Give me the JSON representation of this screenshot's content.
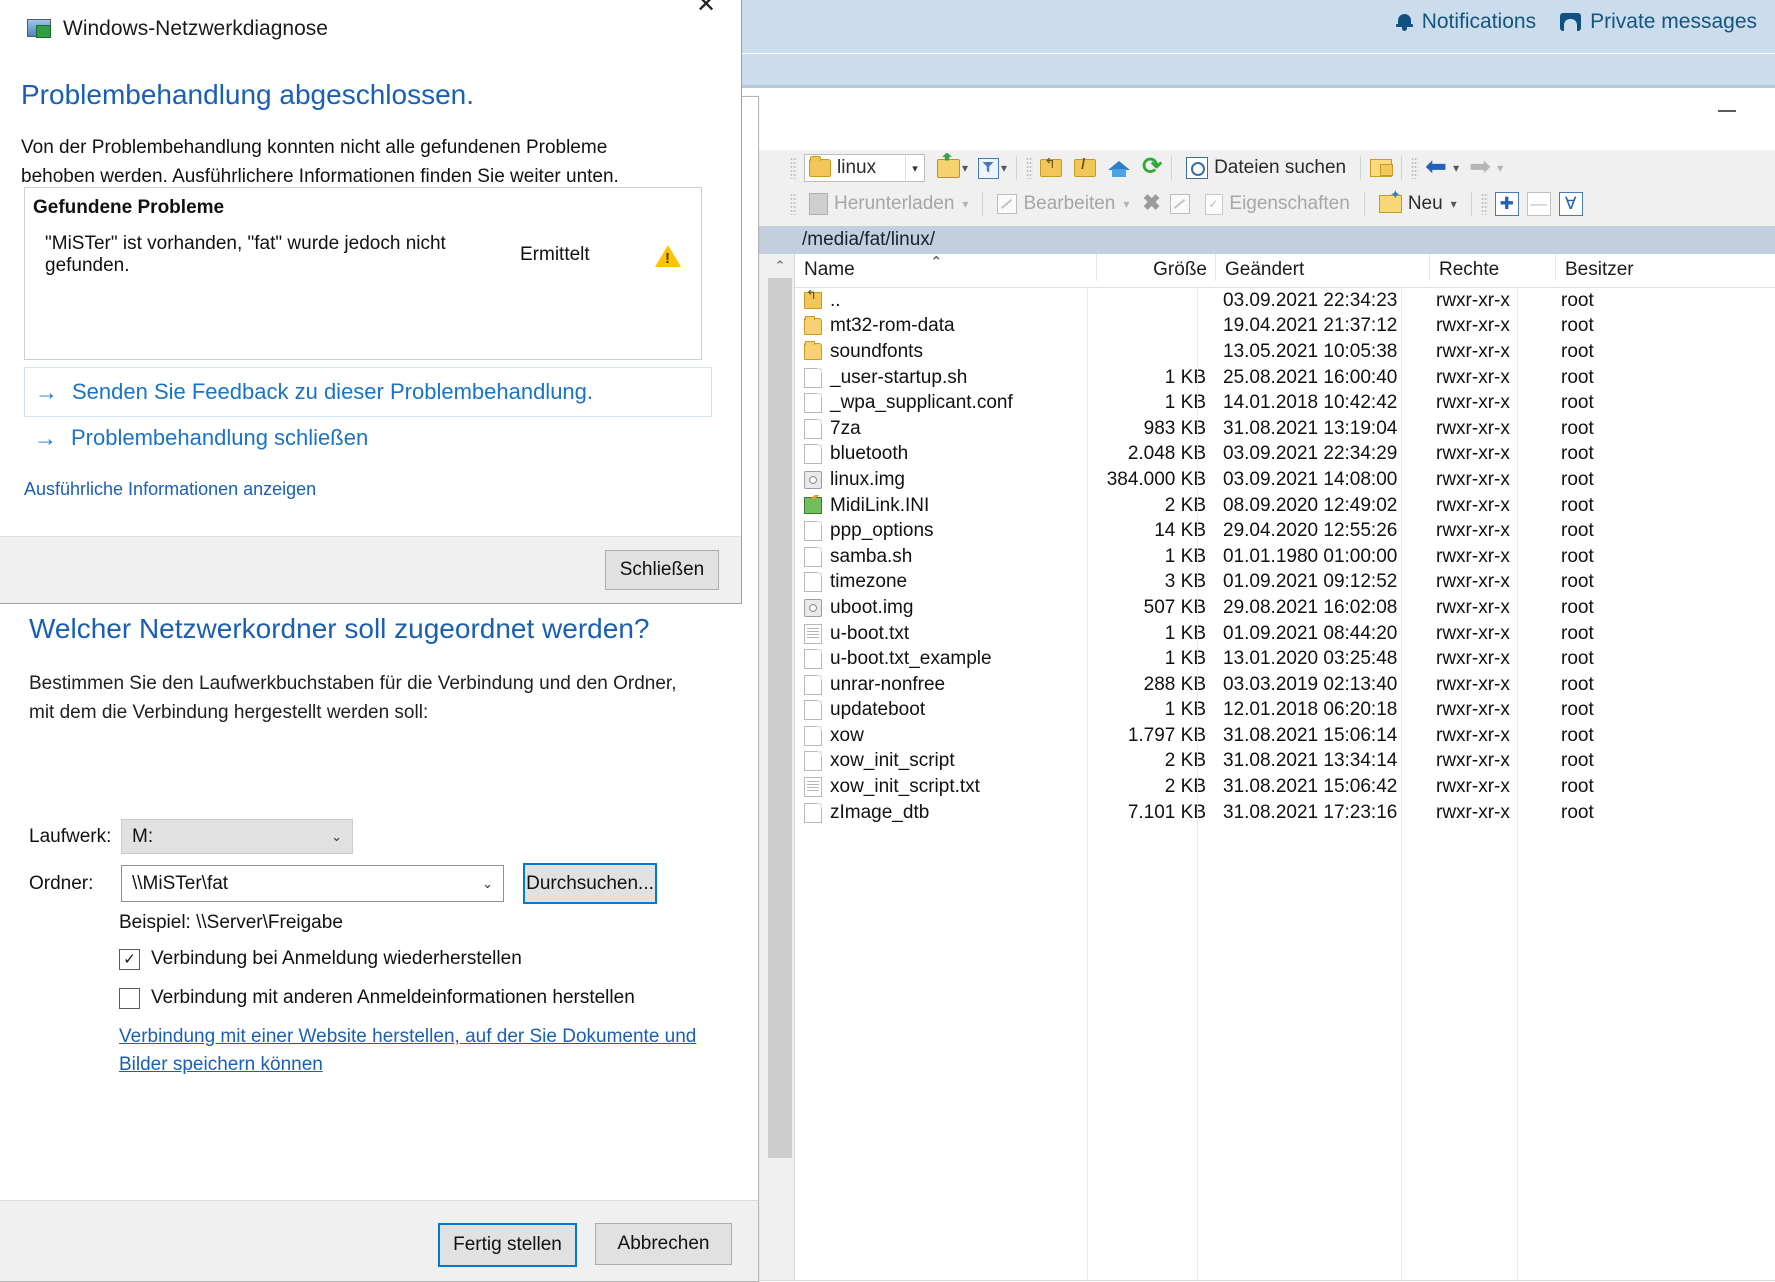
{
  "forum": {
    "notifications_label": "Notifications",
    "private_messages_label": "Private messages"
  },
  "file_manager": {
    "path_combo_value": "linux",
    "toolbar_top": [
      {
        "label": "Dateien suchen",
        "icon": "magnifier-icon"
      }
    ],
    "search_label": "Dateien suchen",
    "toolbar_second": {
      "download_label": "Herunterladen",
      "edit_label": "Bearbeiten",
      "properties_label": "Eigenschaften",
      "new_label": "Neu"
    },
    "path_bar": "/media/fat/linux/",
    "columns": [
      "Name",
      "Größe",
      "Geändert",
      "Rechte",
      "Besitzer"
    ],
    "rows": [
      {
        "icon": "folder-up-icon",
        "name": "..",
        "size": "",
        "modified": "03.09.2021 22:34:23",
        "perm": "rwxr-xr-x",
        "owner": "root"
      },
      {
        "icon": "folder-icon",
        "name": "mt32-rom-data",
        "size": "",
        "modified": "19.04.2021 21:37:12",
        "perm": "rwxr-xr-x",
        "owner": "root"
      },
      {
        "icon": "folder-icon",
        "name": "soundfonts",
        "size": "",
        "modified": "13.05.2021 10:05:38",
        "perm": "rwxr-xr-x",
        "owner": "root"
      },
      {
        "icon": "file-icon",
        "name": "_user-startup.sh",
        "size": "1 KB",
        "modified": "25.08.2021 16:00:40",
        "perm": "rwxr-xr-x",
        "owner": "root"
      },
      {
        "icon": "file-icon",
        "name": "_wpa_supplicant.conf",
        "size": "1 KB",
        "modified": "14.01.2018 10:42:42",
        "perm": "rwxr-xr-x",
        "owner": "root"
      },
      {
        "icon": "file-icon",
        "name": "7za",
        "size": "983 KB",
        "modified": "31.08.2021 13:19:04",
        "perm": "rwxr-xr-x",
        "owner": "root"
      },
      {
        "icon": "file-icon",
        "name": "bluetooth",
        "size": "2.048 KB",
        "modified": "03.09.2021 22:34:29",
        "perm": "rwxr-xr-x",
        "owner": "root"
      },
      {
        "icon": "disc-image-icon",
        "name": "linux.img",
        "size": "384.000 KB",
        "modified": "03.09.2021 14:08:00",
        "perm": "rwxr-xr-x",
        "owner": "root"
      },
      {
        "icon": "ini-file-icon",
        "name": "MidiLink.INI",
        "size": "2 KB",
        "modified": "08.09.2020 12:49:02",
        "perm": "rwxr-xr-x",
        "owner": "root"
      },
      {
        "icon": "file-icon",
        "name": "ppp_options",
        "size": "14 KB",
        "modified": "29.04.2020 12:55:26",
        "perm": "rwxr-xr-x",
        "owner": "root"
      },
      {
        "icon": "file-icon",
        "name": "samba.sh",
        "size": "1 KB",
        "modified": "01.01.1980 01:00:00",
        "perm": "rwxr-xr-x",
        "owner": "root"
      },
      {
        "icon": "file-icon",
        "name": "timezone",
        "size": "3 KB",
        "modified": "01.09.2021 09:12:52",
        "perm": "rwxr-xr-x",
        "owner": "root"
      },
      {
        "icon": "disc-image-icon",
        "name": "uboot.img",
        "size": "507 KB",
        "modified": "29.08.2021 16:02:08",
        "perm": "rwxr-xr-x",
        "owner": "root"
      },
      {
        "icon": "text-file-icon",
        "name": "u-boot.txt",
        "size": "1 KB",
        "modified": "01.09.2021 08:44:20",
        "perm": "rwxr-xr-x",
        "owner": "root"
      },
      {
        "icon": "file-icon",
        "name": "u-boot.txt_example",
        "size": "1 KB",
        "modified": "13.01.2020 03:25:48",
        "perm": "rwxr-xr-x",
        "owner": "root"
      },
      {
        "icon": "file-icon",
        "name": "unrar-nonfree",
        "size": "288 KB",
        "modified": "03.03.2019 02:13:40",
        "perm": "rwxr-xr-x",
        "owner": "root"
      },
      {
        "icon": "file-icon",
        "name": "updateboot",
        "size": "1 KB",
        "modified": "12.01.2018 06:20:18",
        "perm": "rwxr-xr-x",
        "owner": "root"
      },
      {
        "icon": "file-icon",
        "name": "xow",
        "size": "1.797 KB",
        "modified": "31.08.2021 15:06:14",
        "perm": "rwxr-xr-x",
        "owner": "root"
      },
      {
        "icon": "file-icon",
        "name": "xow_init_script",
        "size": "2 KB",
        "modified": "31.08.2021 13:34:14",
        "perm": "rwxr-xr-x",
        "owner": "root"
      },
      {
        "icon": "text-file-icon",
        "name": "xow_init_script.txt",
        "size": "2 KB",
        "modified": "31.08.2021 15:06:42",
        "perm": "rwxr-xr-x",
        "owner": "root"
      },
      {
        "icon": "file-icon",
        "name": "zImage_dtb",
        "size": "7.101 KB",
        "modified": "31.08.2021 17:23:16",
        "perm": "rwxr-xr-x",
        "owner": "root"
      }
    ]
  },
  "wizard": {
    "title": "Welcher Netzwerkordner soll zugeordnet werden?",
    "subtitle": "Bestimmen Sie den Laufwerkbuchstaben für die Verbindung und den Ordner, mit dem die Verbindung hergestellt werden soll:",
    "drive_label": "Laufwerk:",
    "drive_value": "M:",
    "folder_label": "Ordner:",
    "folder_value": "\\\\MiSTer\\fat",
    "browse_label": "Durchsuchen...",
    "example_text": "Beispiel: \\\\Server\\Freigabe",
    "checkbox_reconnect_label": "Verbindung bei Anmeldung wiederherstellen",
    "checkbox_reconnect_checked": "✓",
    "checkbox_credentials_label": "Verbindung mit anderen Anmeldeinformationen herstellen",
    "website_link": "Verbindung mit einer Website herstellen, auf der Sie Dokumente und Bilder speichern können",
    "finish_label": "Fertig stellen",
    "cancel_label": "Abbrechen"
  },
  "troubleshooter": {
    "window_title": "Windows-Netzwerkdiagnose",
    "close_glyph": "✕",
    "heading": "Problembehandlung abgeschlossen.",
    "paragraph": "Von der Problembehandlung konnten nicht alle gefundenen Probleme behoben werden. Ausführlichere Informationen finden Sie weiter unten.",
    "box_heading": "Gefundene Probleme",
    "problem_text": "\"MiSTer\" ist vorhanden, \"fat\" wurde jedoch nicht gefunden.",
    "problem_status": "Ermittelt",
    "feedback_link": "Senden Sie Feedback zu dieser Problembehandlung.",
    "close_link": "Problembehandlung schließen",
    "details_link": "Ausführliche Informationen anzeigen",
    "close_button": "Schließen",
    "arrow_glyph": "→"
  },
  "colors": {
    "accent_blue": "#1a5fb4",
    "link_blue": "#1a73c4",
    "forum_bar": "#cbdced",
    "path_bar": "#c3cfdd",
    "warning_yellow": "#ffc400"
  }
}
